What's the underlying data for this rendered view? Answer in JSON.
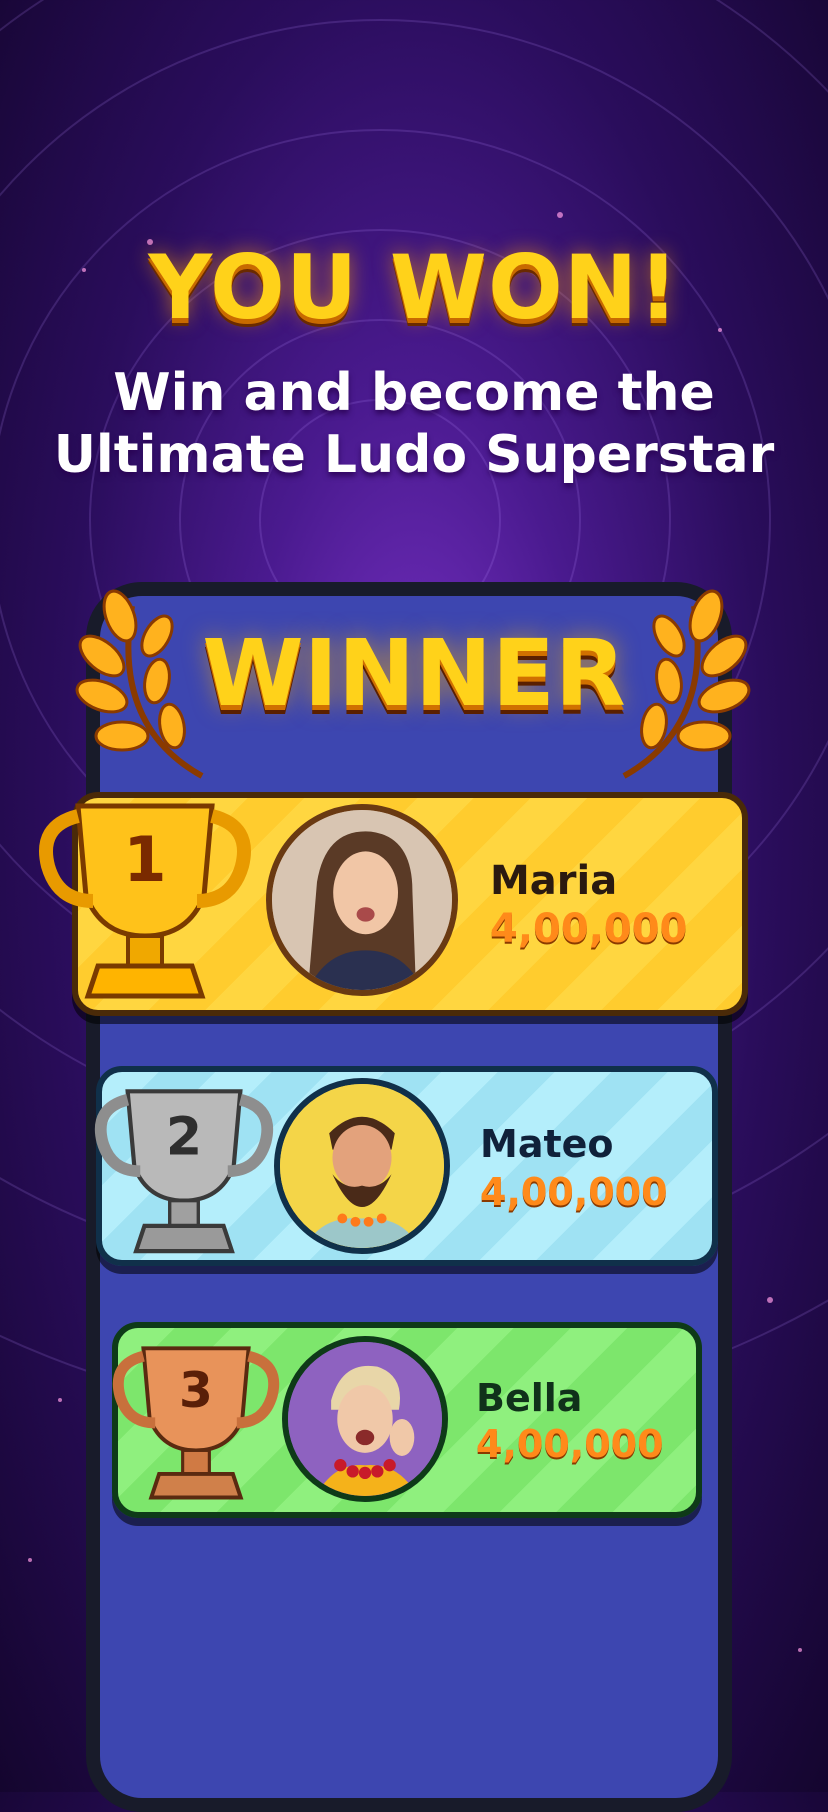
{
  "headline": "YOU WON!",
  "subline": {
    "line1": "Win and become the",
    "line2": "Ultimate Ludo Superstar"
  },
  "banner": "WINNER",
  "players": [
    {
      "rank": "1",
      "name": "Maria",
      "score": "4,00,000",
      "trophy": "gold-trophy-icon"
    },
    {
      "rank": "2",
      "name": "Mateo",
      "score": "4,00,000",
      "trophy": "silver-trophy-icon"
    },
    {
      "rank": "3",
      "name": "Bella",
      "score": "4,00,000",
      "trophy": "bronze-trophy-icon"
    }
  ],
  "colors": {
    "gold": "#ffd640",
    "silver": "#b4eefb",
    "bronze": "#8ff07e",
    "score": "#ff8a1a",
    "phone": "#3d46b0"
  }
}
